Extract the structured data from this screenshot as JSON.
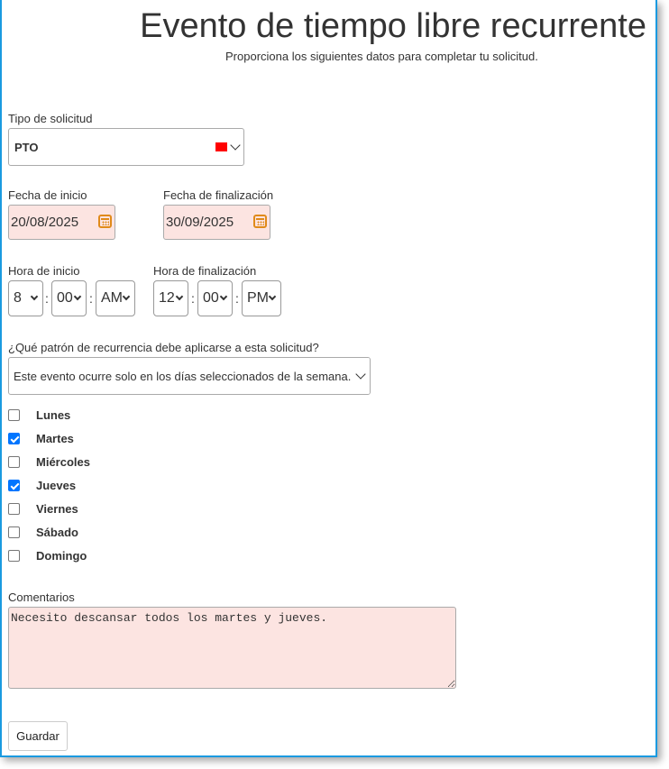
{
  "header": {
    "title": "Evento de tiempo libre recurrente",
    "subtitle": "Proporciona los siguientes datos para completar tu solicitud."
  },
  "request_type": {
    "label": "Tipo de solicitud",
    "value": "PTO",
    "color": "#ff0000"
  },
  "start_date": {
    "label": "Fecha de inicio",
    "value": "20/08/2025"
  },
  "end_date": {
    "label": "Fecha de finalización",
    "value": "30/09/2025"
  },
  "start_time": {
    "label": "Hora de inicio",
    "hour": "8",
    "minute": "00",
    "ampm": "AM",
    "sep": ":"
  },
  "end_time": {
    "label": "Hora de finalización",
    "hour": "12",
    "minute": "00",
    "ampm": "PM",
    "sep": ":"
  },
  "recurrence": {
    "label": "¿Qué patrón de recurrencia debe aplicarse a esta solicitud?",
    "value": "Este evento ocurre solo en los días seleccionados de la semana."
  },
  "days": [
    {
      "label": "Lunes",
      "checked": false
    },
    {
      "label": "Martes",
      "checked": true
    },
    {
      "label": "Miércoles",
      "checked": false
    },
    {
      "label": "Jueves",
      "checked": true
    },
    {
      "label": "Viernes",
      "checked": false
    },
    {
      "label": "Sábado",
      "checked": false
    },
    {
      "label": "Domingo",
      "checked": false
    }
  ],
  "comments": {
    "label": "Comentarios",
    "value": "Necesito descansar todos los martes y jueves."
  },
  "save_label": "Guardar",
  "colors": {
    "accent_border": "#1a9ae0",
    "field_bg": "#fce4e1",
    "checkbox": "#0075ff",
    "calendar_icon": "#e08a1a"
  }
}
